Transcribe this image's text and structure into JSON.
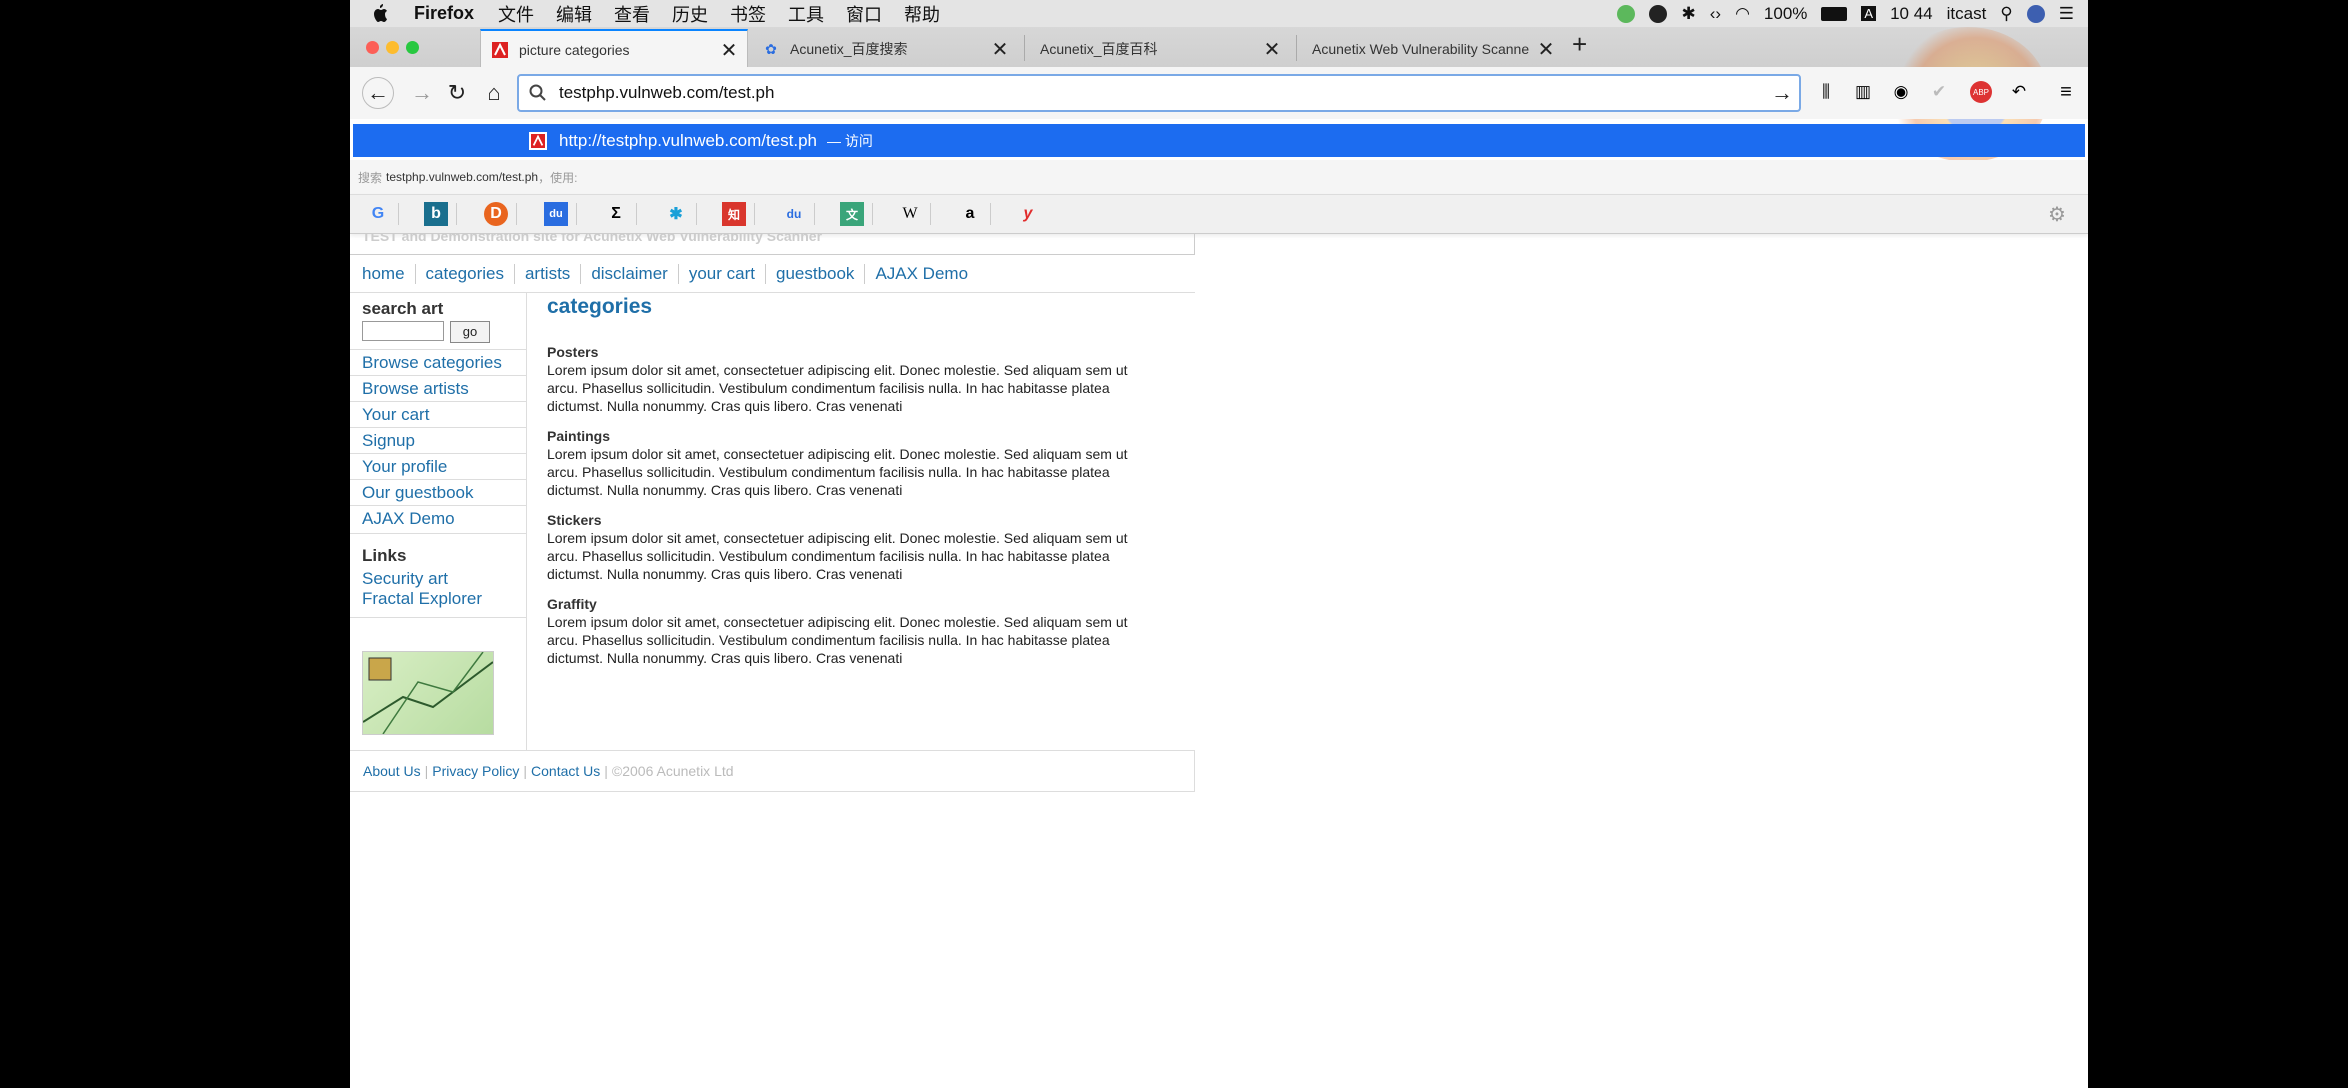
{
  "menubar": {
    "app": "Firefox",
    "items": [
      "文件",
      "编辑",
      "查看",
      "历史",
      "书签",
      "工具",
      "窗口",
      "帮助"
    ],
    "battery": "100%",
    "time": "10 44",
    "user": "itcast"
  },
  "tabs": [
    {
      "label": "picture categories",
      "active": true
    },
    {
      "label": "Acunetix_百度搜索",
      "active": false
    },
    {
      "label": "Acunetix_百度百科",
      "active": false
    },
    {
      "label": "Acunetix Web Vulnerability Scanne",
      "active": false
    }
  ],
  "urlbar": {
    "value": "testphp.vulnweb.com/test.ph"
  },
  "suggestion": {
    "url": "http://testphp.vulnweb.com/test.ph",
    "action": "— 访问"
  },
  "search_hint": {
    "prefix": "搜索",
    "query": "testphp.vulnweb.com/test.ph",
    "suffix": "，使用:"
  },
  "bookmarks": [
    "G",
    "b",
    "D",
    "du",
    "Σ",
    "✱",
    "知",
    "du",
    "文",
    "W",
    "a",
    "y"
  ],
  "site": {
    "header_text": "TEST and Demonstration site for Acunetix Web Vulnerability Scanner",
    "nav": [
      "home",
      "categories",
      "artists",
      "disclaimer",
      "your cart",
      "guestbook",
      "AJAX Demo"
    ],
    "search_title": "search art",
    "search_button": "go",
    "sidebar_links": [
      "Browse categories",
      "Browse artists",
      "Your cart",
      "Signup",
      "Your profile",
      "Our guestbook",
      "AJAX Demo"
    ],
    "links_title": "Links",
    "links": [
      "Security art",
      "Fractal Explorer"
    ],
    "page_title": "categories",
    "categories": [
      {
        "title": "Posters",
        "text": "Lorem ipsum dolor sit amet, consectetuer adipiscing elit. Donec molestie. Sed aliquam sem ut arcu. Phasellus sollicitudin. Vestibulum condimentum facilisis nulla. In hac habitasse platea dictumst. Nulla nonummy. Cras quis libero. Cras venenati"
      },
      {
        "title": "Paintings",
        "text": "Lorem ipsum dolor sit amet, consectetuer adipiscing elit. Donec molestie. Sed aliquam sem ut arcu. Phasellus sollicitudin. Vestibulum condimentum facilisis nulla. In hac habitasse platea dictumst. Nulla nonummy. Cras quis libero. Cras venenati"
      },
      {
        "title": "Stickers",
        "text": "Lorem ipsum dolor sit amet, consectetuer adipiscing elit. Donec molestie. Sed aliquam sem ut arcu. Phasellus sollicitudin. Vestibulum condimentum facilisis nulla. In hac habitasse platea dictumst. Nulla nonummy. Cras quis libero. Cras venenati"
      },
      {
        "title": "Graffity",
        "text": "Lorem ipsum dolor sit amet, consectetuer adipiscing elit. Donec molestie. Sed aliquam sem ut arcu. Phasellus sollicitudin. Vestibulum condimentum facilisis nulla. In hac habitasse platea dictumst. Nulla nonummy. Cras quis libero. Cras venenati"
      }
    ],
    "footer": {
      "about": "About Us",
      "privacy": "Privacy Policy",
      "contact": "Contact Us",
      "copyright": "©2006 Acunetix Ltd"
    }
  },
  "colors": {
    "accent": "#1c6cf0",
    "link": "#1f6fa8",
    "menubar": "#e4e4e4"
  }
}
